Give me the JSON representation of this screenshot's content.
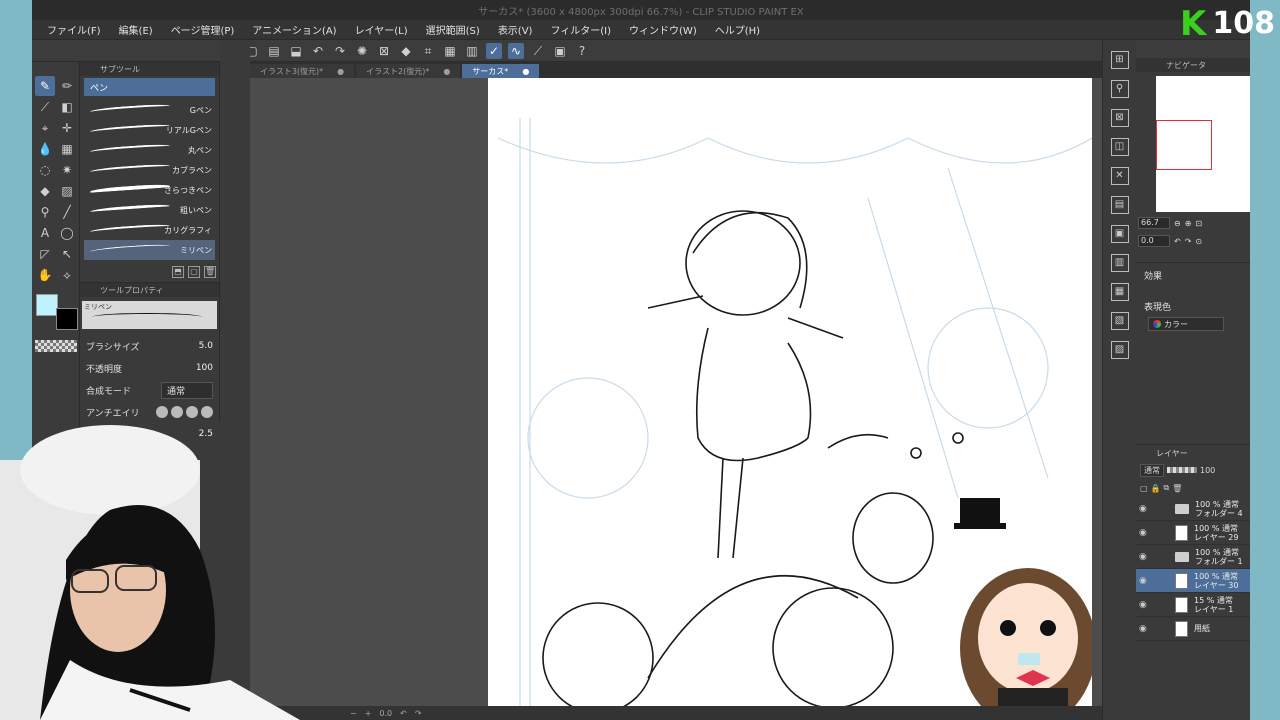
{
  "window": {
    "title": "サーカス* (3600 x 4800px 300dpi 66.7%)  - CLIP STUDIO PAINT EX"
  },
  "menu": [
    "ファイル(F)",
    "編集(E)",
    "ページ管理(P)",
    "アニメーション(A)",
    "レイヤー(L)",
    "選択範囲(S)",
    "表示(V)",
    "フィルター(I)",
    "ウィンドウ(W)",
    "ヘルプ(H)"
  ],
  "subtool": {
    "header": "サブツール",
    "tab": "ペン",
    "brushes": [
      "Gペン",
      "リアルGペン",
      "丸ペン",
      "カブラペン",
      "さらつきペン",
      "粗いペン",
      "カリグラフィ",
      "ミリペン"
    ]
  },
  "toolprop": {
    "header": "ツールプロパティ",
    "preview_name": "ミリペン",
    "brush_size_label": "ブラシサイズ",
    "brush_size": "5.0",
    "opacity_label": "不透明度",
    "opacity": "100",
    "blend_label": "合成モード",
    "blend": "通常",
    "aa_label": "アンチエイリ",
    "extra_value": "2.5"
  },
  "tabs": [
    {
      "label": "イラスト3(復元)*"
    },
    {
      "label": "イラスト2(復元)*"
    },
    {
      "label": "サーカス*"
    }
  ],
  "navigator": {
    "header": "ナビゲータ",
    "zoom": "66.7",
    "rotate": "0.0"
  },
  "effect": {
    "header": "効果",
    "expression_label": "表現色",
    "expression_value": "カラー"
  },
  "layers": {
    "header": "レイヤー",
    "blend": "通常",
    "opacity": "100",
    "items": [
      {
        "line1": "100 % 通常",
        "line2": "フォルダー 4",
        "type": "folder"
      },
      {
        "line1": "100 % 通常",
        "line2": "レイヤー 29",
        "type": "layer"
      },
      {
        "line1": "100 % 通常",
        "line2": "フォルダー 1",
        "type": "folder"
      },
      {
        "line1": "100 % 通常",
        "line2": "レイヤー 30",
        "type": "layer"
      },
      {
        "line1": "15 % 通常",
        "line2": "レイヤー 1",
        "type": "layer"
      },
      {
        "line1": "",
        "line2": "用紙",
        "type": "paper"
      }
    ]
  },
  "status": {
    "zoom": "0.0"
  },
  "overlay": {
    "k": "K",
    "number": "108"
  },
  "colors": {
    "accent": "#4d6e99",
    "main_color": "#bff2ff",
    "sub_color": "#000000",
    "badge_green": "#39d11a"
  },
  "icons": [
    "pen-icon",
    "eraser-icon",
    "lasso-icon",
    "fill-icon",
    "text-icon",
    "hand-icon",
    "eyedropper-icon",
    "undo-icon",
    "redo-icon"
  ]
}
